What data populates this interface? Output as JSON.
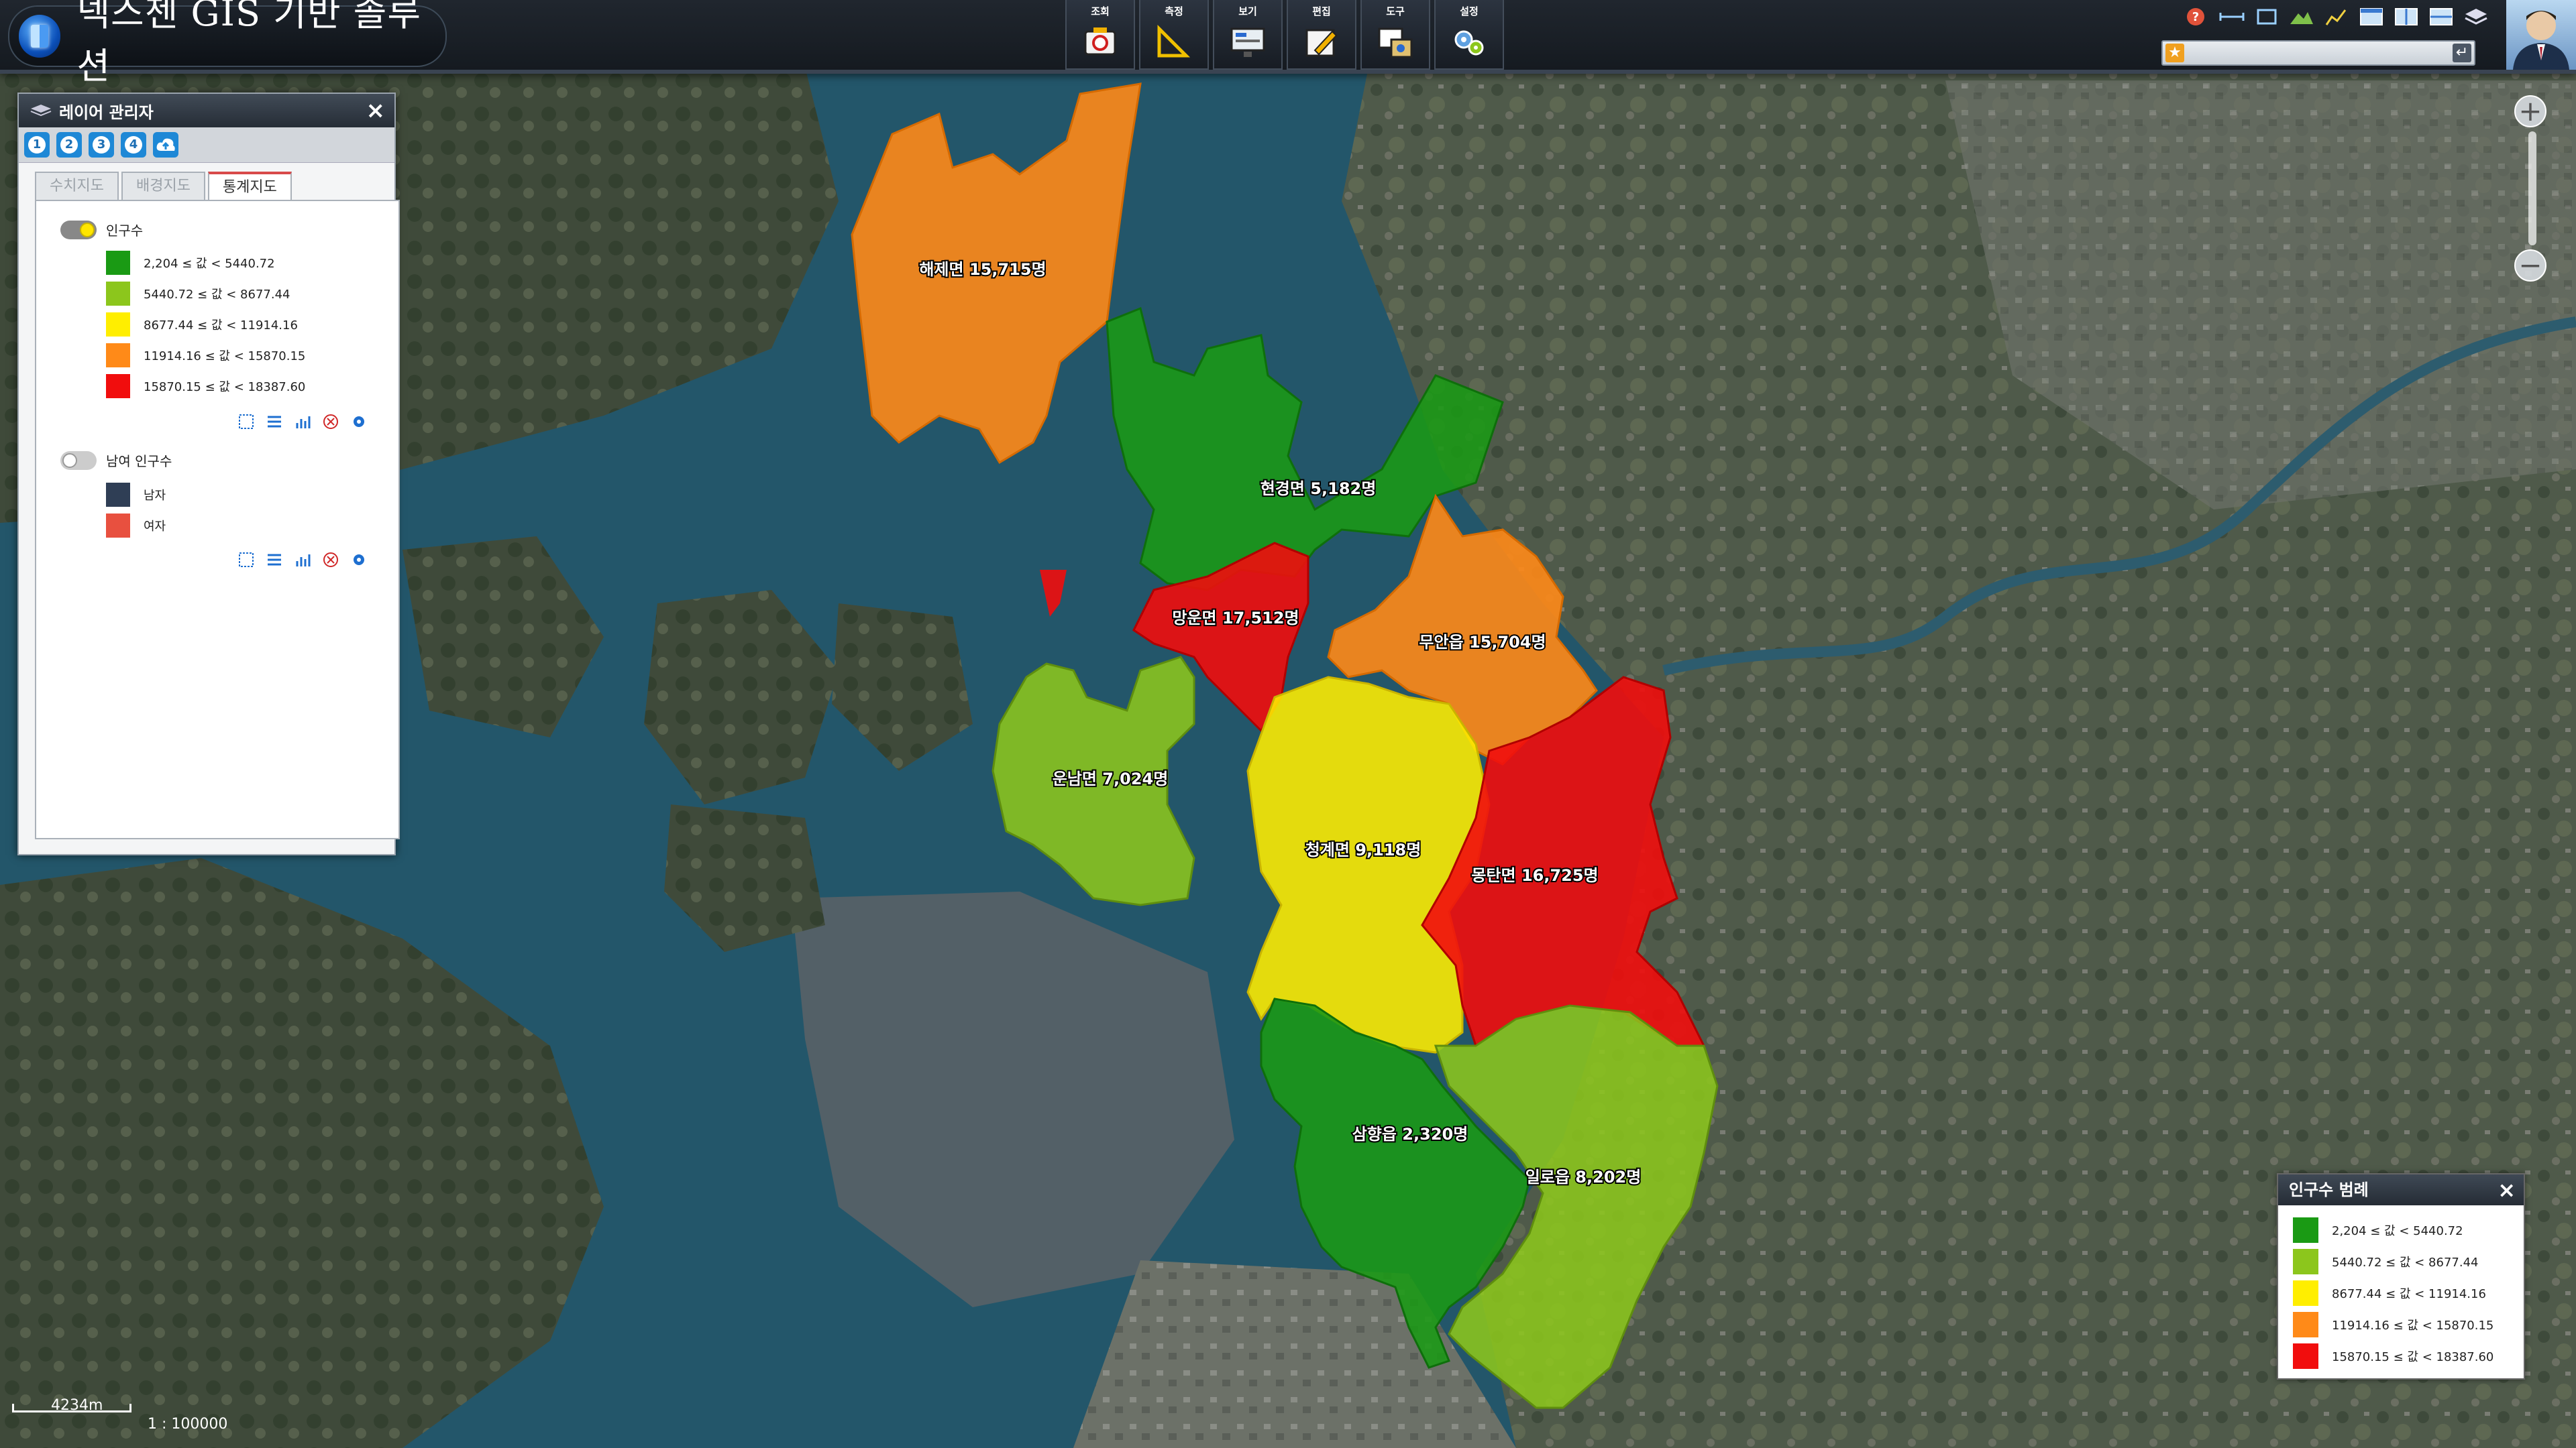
{
  "app": {
    "title": "넥스젠 GIS 기반 솔루션"
  },
  "menu": [
    {
      "label": "조회",
      "icon": "camera-icon"
    },
    {
      "label": "측정",
      "icon": "ruler-icon"
    },
    {
      "label": "보기",
      "icon": "monitor-icon"
    },
    {
      "label": "편집",
      "icon": "edit-icon"
    },
    {
      "label": "도구",
      "icon": "tools-icon"
    },
    {
      "label": "설정",
      "icon": "settings-icon"
    }
  ],
  "layer_manager": {
    "title": "레이어 관리자",
    "presets": [
      "1",
      "2",
      "3",
      "4"
    ],
    "tabs": [
      "수치지도",
      "배경지도",
      "통계지도"
    ],
    "active_tab": "통계지도",
    "layers": [
      {
        "name": "인구수",
        "enabled": true,
        "items": [
          {
            "label": "2,204 ≤ 값 < 5440.72",
            "color": "#1a9a14"
          },
          {
            "label": "5440.72 ≤ 값 < 8677.44",
            "color": "#8cc61c"
          },
          {
            "label": "8677.44 ≤ 값 < 11914.16",
            "color": "#ffee00"
          },
          {
            "label": "11914.16 ≤ 값 < 15870.15",
            "color": "#ff8a18"
          },
          {
            "label": "15870.15 ≤ 값 < 18387.60",
            "color": "#f10d0d"
          }
        ]
      },
      {
        "name": "남여 인구수",
        "enabled": false,
        "items": [
          {
            "label": "남자",
            "color": "#2f3e55"
          },
          {
            "label": "여자",
            "color": "#e8503f"
          }
        ]
      }
    ]
  },
  "legend": {
    "title": "인구수 범례",
    "items": [
      {
        "label": "2,204 ≤ 값 < 5440.72",
        "color": "#1a9a14"
      },
      {
        "label": "5440.72 ≤ 값 < 8677.44",
        "color": "#8cc61c"
      },
      {
        "label": "8677.44 ≤ 값 < 11914.16",
        "color": "#ffee00"
      },
      {
        "label": "11914.16 ≤ 값 < 15870.15",
        "color": "#ff8a18"
      },
      {
        "label": "15870.15 ≤ 값 < 18387.60",
        "color": "#f10d0d"
      }
    ]
  },
  "regions": [
    {
      "name": "해제면 15,715명",
      "class": 3
    },
    {
      "name": "현경면 5,182명",
      "class": 0
    },
    {
      "name": "망운면 17,512명",
      "class": 4
    },
    {
      "name": "운남면 7,024명",
      "class": 1
    },
    {
      "name": "무안읍 15,704명",
      "class": 3
    },
    {
      "name": "청계면 9,118명",
      "class": 2
    },
    {
      "name": "몽탄면 16,725명",
      "class": 4
    },
    {
      "name": "삼향읍 2,320명",
      "class": 0
    },
    {
      "name": "일로읍 8,202명",
      "class": 1
    }
  ],
  "scale": {
    "distance": "4234m",
    "ratio": "1 : 100000"
  }
}
